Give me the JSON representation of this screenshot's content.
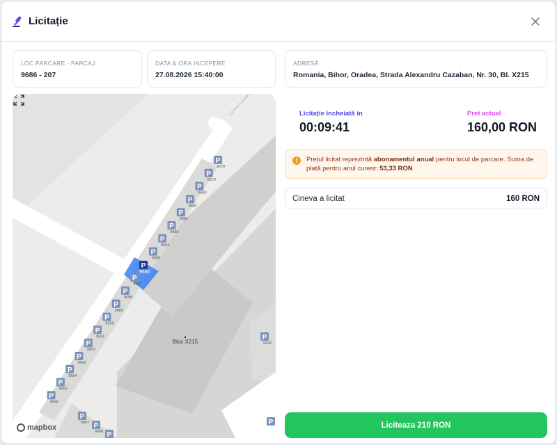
{
  "header": {
    "title": "Licitație",
    "title_icon": "gavel-icon",
    "close_icon": "close-icon"
  },
  "info_cards": {
    "spot": {
      "label": "LOC PARCARE - PARCAJ",
      "value": "9686 - 207"
    },
    "start": {
      "label": "DATA & ORA INCEPERE",
      "value": "27.08.2026 15:40:00"
    },
    "address": {
      "label": "ADRESĂ",
      "value": "Romania, Bihor, Oradea, Strada Alexandru Cazaban, Nr. 30, Bl. X215"
    }
  },
  "map": {
    "building_label": "Bloc X215",
    "selected_spot": "9686",
    "spots_right_column": [
      "9678",
      "9679",
      "9680",
      "9681",
      "9682",
      "9683",
      "9684",
      "9685",
      "9687",
      "9688",
      "9689",
      "9690",
      "9691",
      "9692",
      "9693",
      "9694",
      "9695",
      "9696"
    ],
    "spots_bottom": [
      "9697",
      "9698"
    ],
    "spot_far_right": "9442",
    "attribution": "mapbox",
    "expand_icon": "expand-icon"
  },
  "auction": {
    "timer_label": "Licitație încheiată în",
    "timer_value": "00:09:41",
    "price_label": "Pret actual",
    "price_value": "160,00 RON"
  },
  "notice": {
    "text_1": "Prețul licitat reprezintă ",
    "bold_1": "abonamentul anual",
    "text_2": " pentru locul de parcare. Suma de plată pentru anul curent: ",
    "bold_2": "53,33 RON"
  },
  "last_bid": {
    "who": "Cineva a licitat",
    "amount": "160 RON"
  },
  "cta": {
    "label": "Liciteaza 210 RON"
  },
  "colors": {
    "accent": "#4f46e5",
    "price": "#d946ef",
    "cta": "#22c55e",
    "notice_bg": "#fff7ed",
    "selected_spot": "#3b82f6"
  }
}
